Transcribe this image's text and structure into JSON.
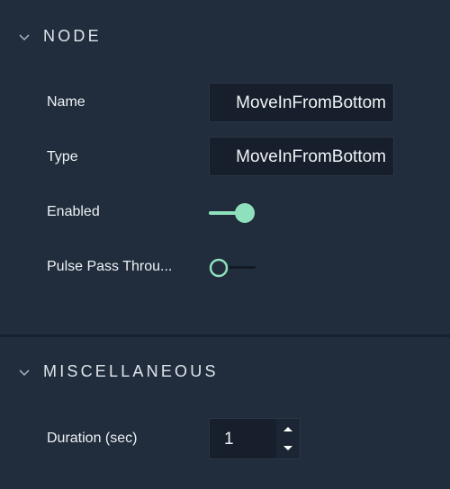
{
  "node_section": {
    "title": "NODE",
    "name_label": "Name",
    "name_value": "MoveInFromBottom",
    "type_label": "Type",
    "type_value": "MoveInFromBottom",
    "enabled_label": "Enabled",
    "enabled_on": true,
    "pulse_label": "Pulse Pass Throu...",
    "pulse_on": false
  },
  "misc_section": {
    "title": "MISCELLANEOUS",
    "duration_label": "Duration (sec)",
    "duration_value": "1"
  },
  "colors": {
    "background": "#212c3c",
    "accent": "#8fe1bd",
    "field_bg": "#161f2b"
  },
  "icons": [
    "chevron-down-icon",
    "spin-up-icon",
    "spin-down-icon"
  ]
}
